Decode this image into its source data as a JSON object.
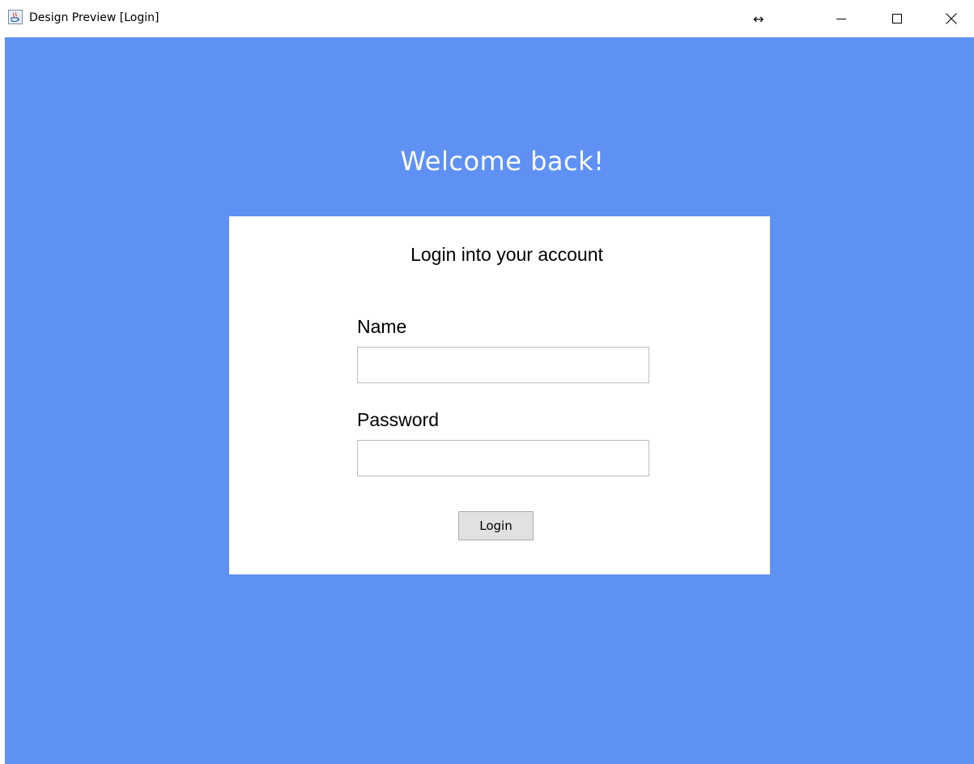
{
  "window": {
    "title": "Design Preview [Login]",
    "icon": "java-app-icon",
    "controls": {
      "resize_glyph": "↔",
      "minimize_glyph": "—",
      "maximize_glyph": "☐",
      "close_glyph": "✕"
    }
  },
  "login": {
    "welcome": "Welcome back!",
    "subtitle": "Login into your account",
    "name_label": "Name",
    "name_value": "",
    "password_label": "Password",
    "password_value": "",
    "button_label": "Login"
  },
  "colors": {
    "background": "#5f91f5",
    "card": "#ffffff",
    "welcome_text": "#ffffff",
    "button": "#e1e1e1"
  }
}
